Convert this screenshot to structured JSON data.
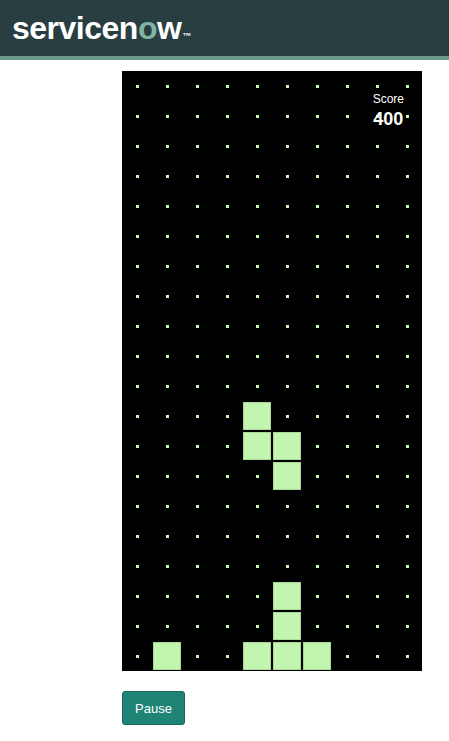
{
  "header": {
    "logo": {
      "before": "servicen",
      "accent": "o",
      "after": "w",
      "mark": "™"
    }
  },
  "board": {
    "score_label": "Score",
    "score": "400",
    "grid": [
      [
        0,
        0,
        0,
        0,
        0,
        0,
        0,
        0,
        0,
        0
      ],
      [
        0,
        0,
        0,
        0,
        0,
        0,
        0,
        0,
        0,
        0
      ],
      [
        0,
        0,
        0,
        0,
        0,
        0,
        0,
        0,
        0,
        0
      ],
      [
        0,
        0,
        0,
        0,
        0,
        0,
        0,
        0,
        0,
        0
      ],
      [
        0,
        0,
        0,
        0,
        0,
        0,
        0,
        0,
        0,
        0
      ],
      [
        0,
        0,
        0,
        0,
        0,
        0,
        0,
        0,
        0,
        0
      ],
      [
        0,
        0,
        0,
        0,
        0,
        0,
        0,
        0,
        0,
        0
      ],
      [
        0,
        0,
        0,
        0,
        0,
        0,
        0,
        0,
        0,
        0
      ],
      [
        0,
        0,
        0,
        0,
        0,
        0,
        0,
        0,
        0,
        0
      ],
      [
        0,
        0,
        0,
        0,
        0,
        0,
        0,
        0,
        0,
        0
      ],
      [
        0,
        0,
        0,
        0,
        0,
        0,
        0,
        0,
        0,
        0
      ],
      [
        0,
        0,
        0,
        0,
        1,
        0,
        0,
        0,
        0,
        0
      ],
      [
        0,
        0,
        0,
        0,
        1,
        1,
        0,
        0,
        0,
        0
      ],
      [
        0,
        0,
        0,
        0,
        0,
        1,
        0,
        0,
        0,
        0
      ],
      [
        0,
        0,
        0,
        0,
        0,
        0,
        0,
        0,
        0,
        0
      ],
      [
        0,
        0,
        0,
        0,
        0,
        0,
        0,
        0,
        0,
        0
      ],
      [
        0,
        0,
        0,
        0,
        0,
        0,
        0,
        0,
        0,
        0
      ],
      [
        0,
        0,
        0,
        0,
        0,
        1,
        0,
        0,
        0,
        0
      ],
      [
        0,
        0,
        0,
        0,
        0,
        1,
        0,
        0,
        0,
        0
      ],
      [
        0,
        1,
        0,
        0,
        1,
        1,
        1,
        0,
        0,
        0
      ]
    ]
  },
  "buttons": [
    {
      "label": "Pause"
    }
  ]
}
